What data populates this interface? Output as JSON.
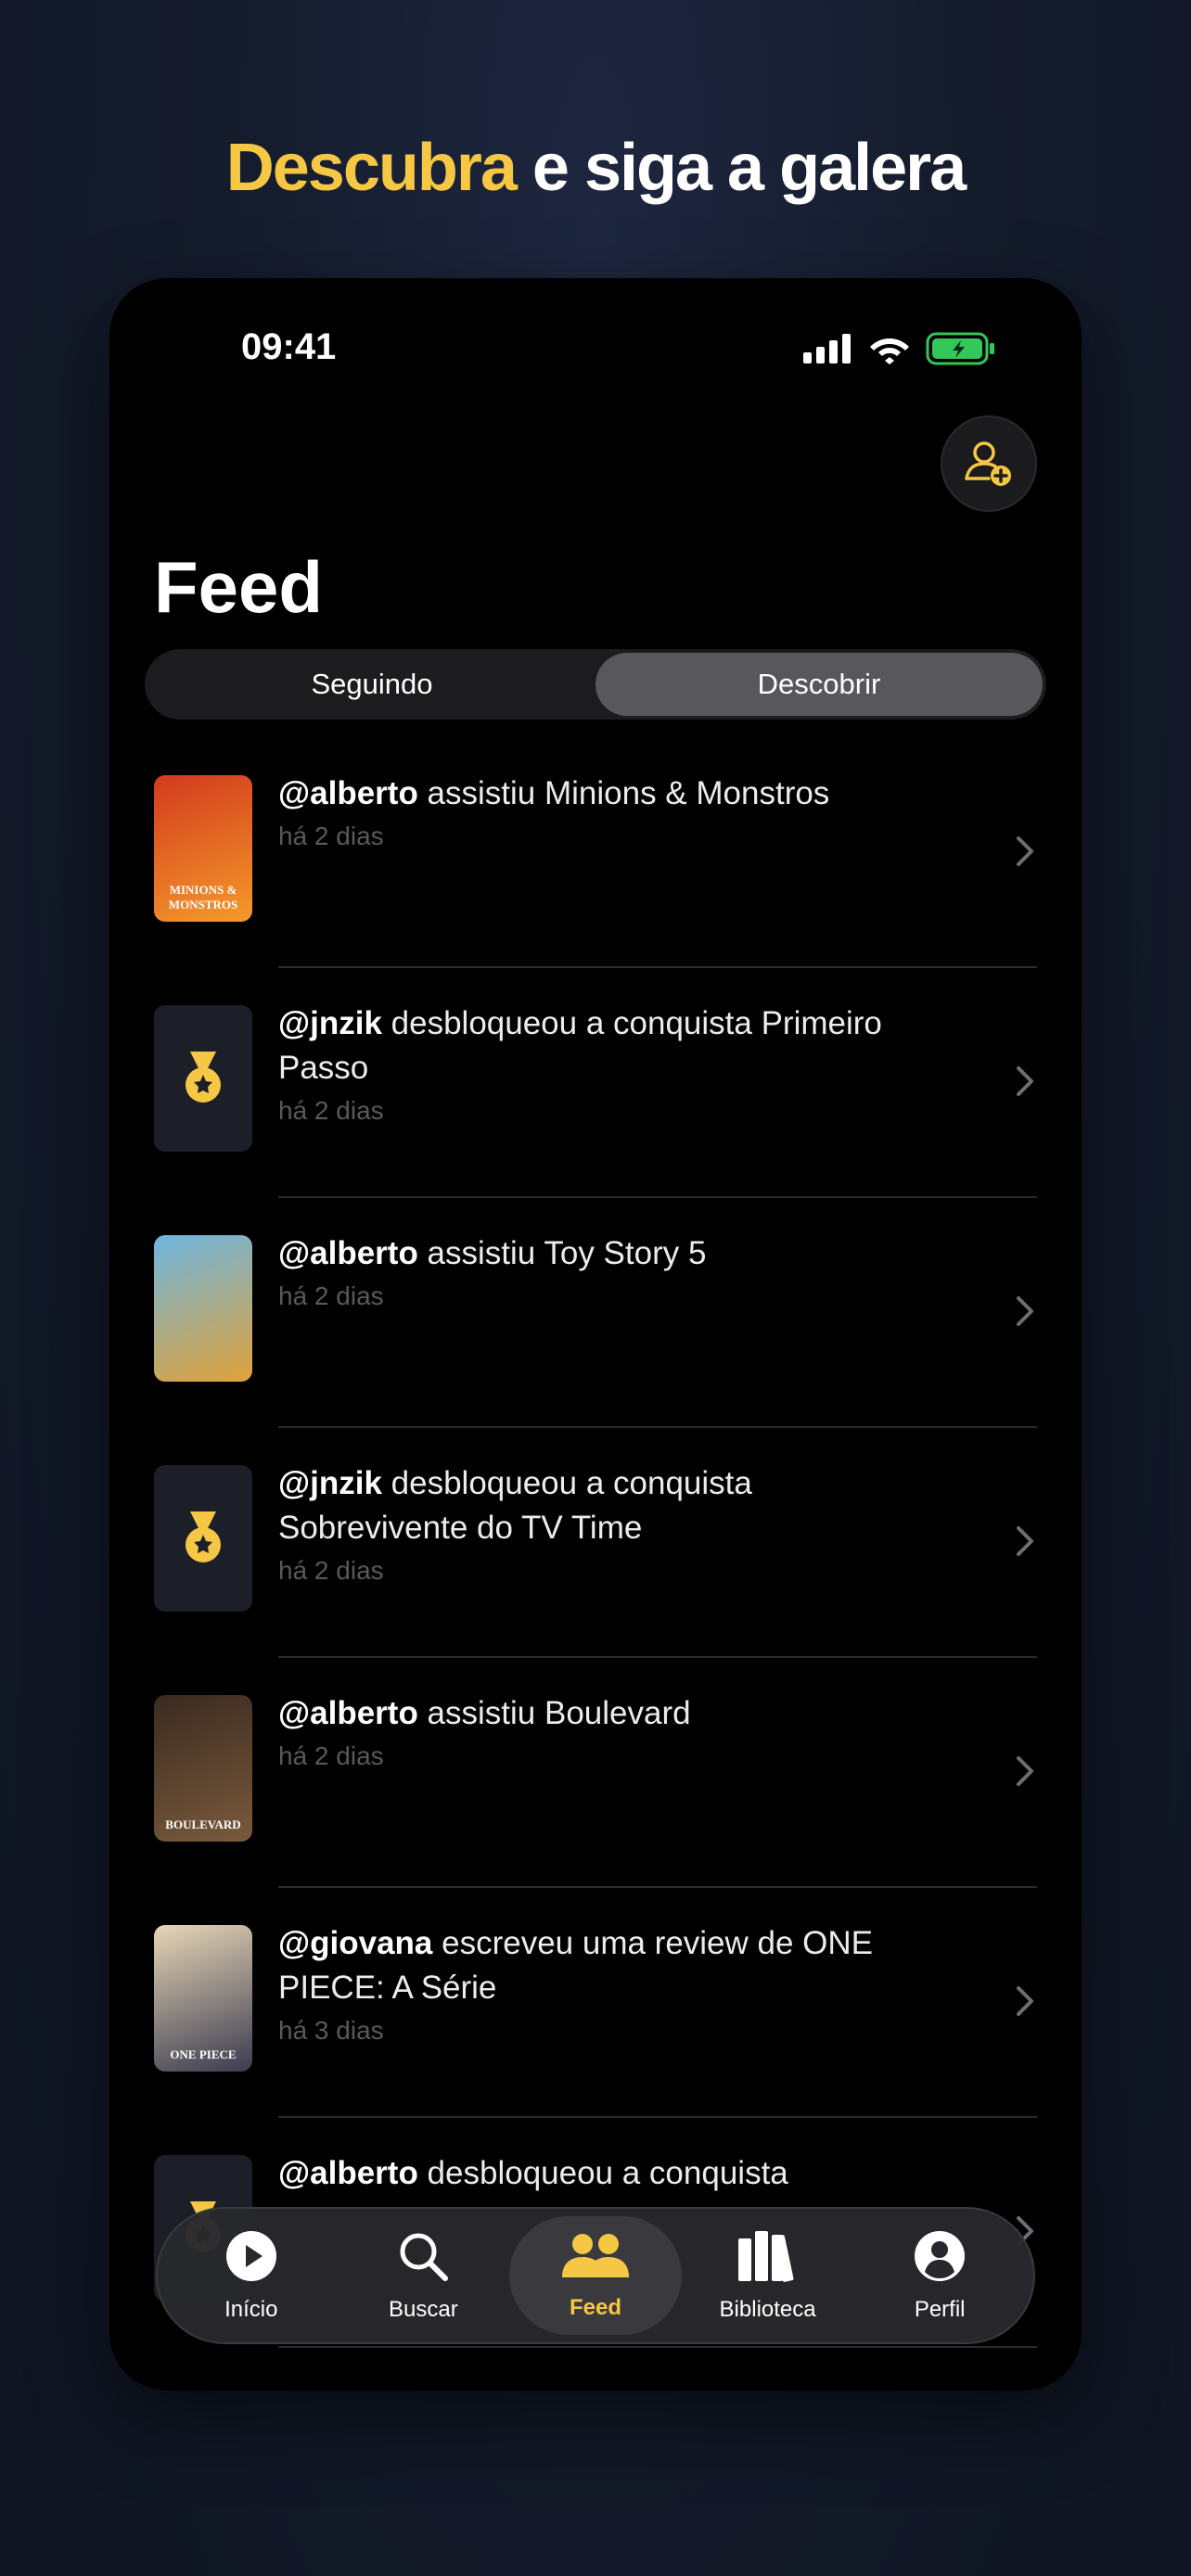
{
  "headline": {
    "accent": "Descubra",
    "rest": " e siga a galera"
  },
  "status_bar": {
    "time": "09:41"
  },
  "page": {
    "title": "Feed"
  },
  "segments": {
    "following": "Seguindo",
    "discover": "Descobrir",
    "active": "Descobrir"
  },
  "feed": [
    {
      "user": "@alberto",
      "action": " assistiu Minions & Monstros",
      "time": "há 2 dias",
      "thumb": "poster",
      "poster_title": "MINIONS & MONSTROS",
      "colors": [
        "#d23a1e",
        "#f59a2a"
      ]
    },
    {
      "user": "@jnzik",
      "action": " desbloqueou a conquista Primeiro Passo",
      "time": "há 2 dias",
      "thumb": "medal"
    },
    {
      "user": "@alberto",
      "action": " assistiu Toy Story 5",
      "time": "há 2 dias",
      "thumb": "poster",
      "poster_title": "",
      "colors": [
        "#6fb6e0",
        "#e0a23a"
      ]
    },
    {
      "user": "@jnzik",
      "action": " desbloqueou a conquista Sobrevivente do TV Time",
      "time": "há 2 dias",
      "thumb": "medal"
    },
    {
      "user": "@alberto",
      "action": " assistiu Boulevard",
      "time": "há 2 dias",
      "thumb": "poster",
      "poster_title": "BOULEVARD",
      "colors": [
        "#3a2a20",
        "#7a5a3c"
      ]
    },
    {
      "user": "@giovana",
      "action": " escreveu uma review de ONE PIECE: A Série",
      "time": "há 3 dias",
      "thumb": "poster",
      "poster_title": "ONE PIECE",
      "colors": [
        "#e7d6b6",
        "#3b3b50"
      ]
    },
    {
      "user": "@alberto",
      "action": " desbloqueou a conquista",
      "time": "",
      "thumb": "medal"
    }
  ],
  "tab_bar": {
    "items": [
      {
        "label": "Início",
        "icon": "play-circle-icon"
      },
      {
        "label": "Buscar",
        "icon": "search-icon"
      },
      {
        "label": "Feed",
        "icon": "people-icon"
      },
      {
        "label": "Biblioteca",
        "icon": "books-icon"
      },
      {
        "label": "Perfil",
        "icon": "profile-icon"
      }
    ],
    "active": "Feed"
  },
  "colors": {
    "accent": "#f5c744",
    "background": "#000000",
    "battery": "#34c759"
  }
}
